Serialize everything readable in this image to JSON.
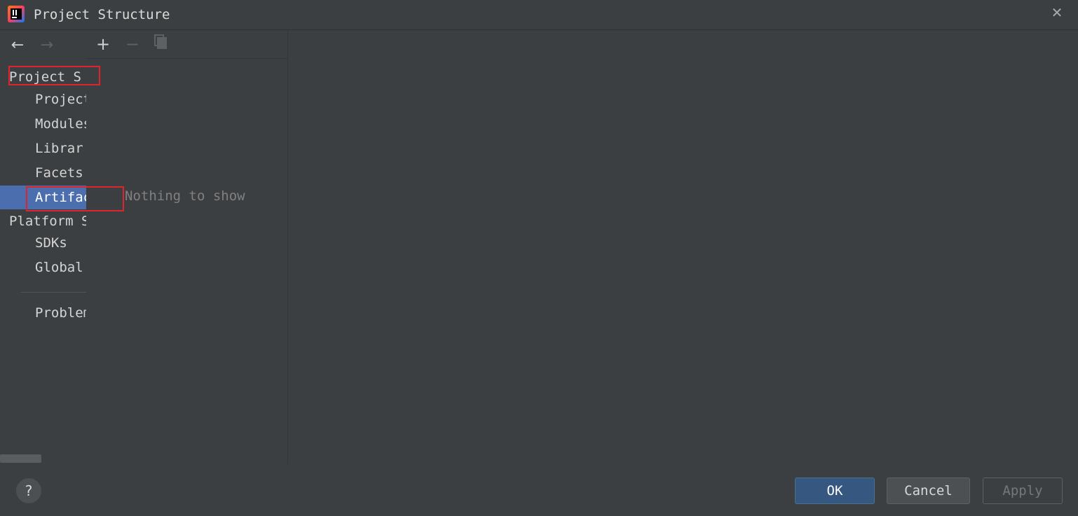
{
  "window": {
    "title": "Project Structure",
    "close_icon": "close-icon"
  },
  "nav": {
    "back_icon": "arrow-left-icon",
    "forward_icon": "arrow-right-icon",
    "items": [
      {
        "label": "Project S",
        "kind": "section"
      },
      {
        "label": "Project",
        "kind": "child"
      },
      {
        "label": "Modules",
        "kind": "child"
      },
      {
        "label": "Librar",
        "kind": "child"
      },
      {
        "label": "Facets",
        "kind": "child"
      },
      {
        "label": "Artifacts",
        "kind": "child",
        "selected": true
      },
      {
        "label": "Platform S",
        "kind": "section"
      },
      {
        "label": "SDKs",
        "kind": "child"
      },
      {
        "label": "Global",
        "kind": "child"
      },
      {
        "label": "Problem",
        "kind": "child"
      }
    ]
  },
  "toolbar": {
    "add_symbol": "+",
    "remove_symbol": "−"
  },
  "artifacts_panel": {
    "empty_text": "Nothing to show"
  },
  "footer": {
    "help_label": "?",
    "ok_label": "OK",
    "cancel_label": "Cancel",
    "apply_label": "Apply"
  },
  "colors": {
    "background": "#3c3f41",
    "selection": "#4b6eaf",
    "annotation": "#e0242f",
    "ok_button": "#365880"
  }
}
